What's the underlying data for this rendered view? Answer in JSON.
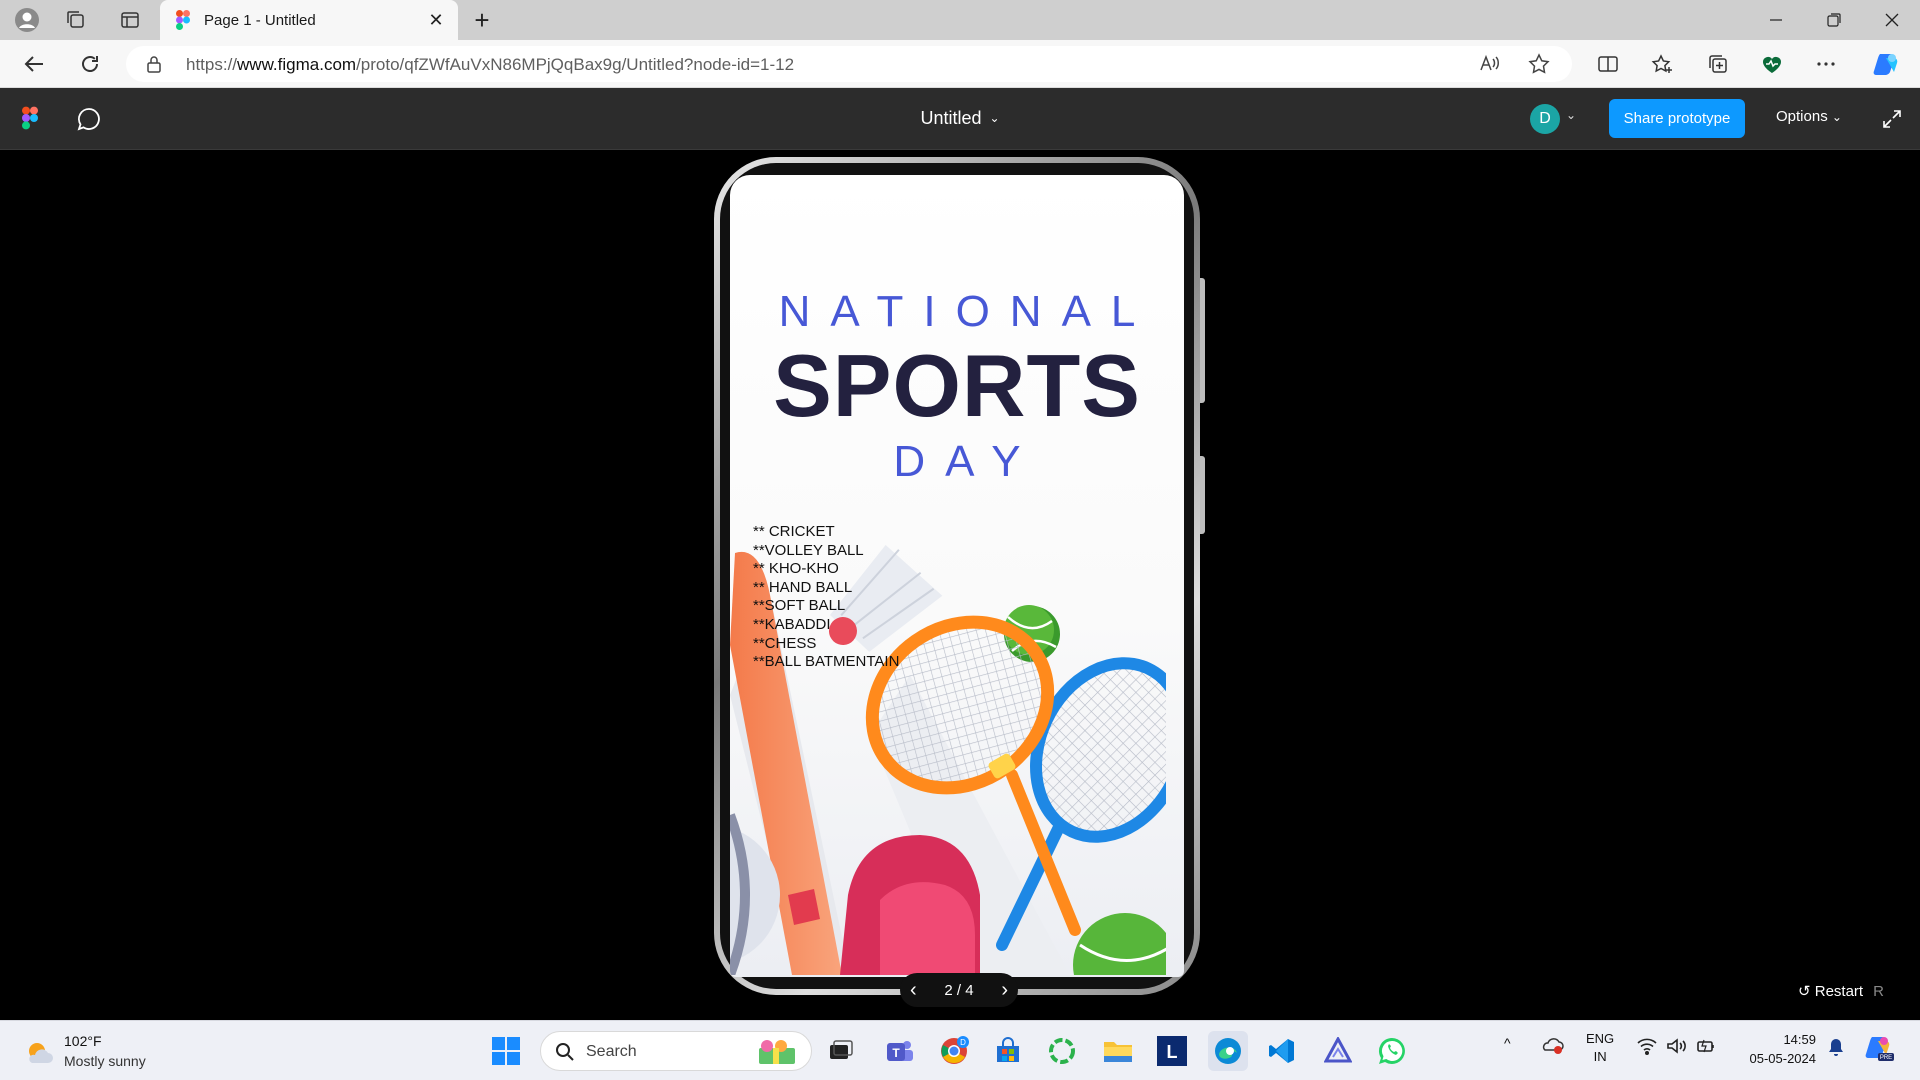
{
  "browser": {
    "tab_title": "Page 1 - Untitled",
    "url_prefix": "https://",
    "url_domain": "www.figma.com",
    "url_path": "/proto/qfZWfAuVxN86MPjQqBax9g/Untitled?node-id=1-12"
  },
  "figma": {
    "file_title": "Untitled",
    "avatar_letter": "D",
    "share_label": "Share prototype",
    "options_label": "Options",
    "pager_text": "2 / 4",
    "restart_label": "Restart",
    "restart_key": "R",
    "accent_color": "#0d99ff"
  },
  "poster": {
    "line1": "NATIONAL",
    "line2": "SPORTS",
    "line3": "DAY",
    "sports": [
      "** CRICKET",
      "**VOLLEY BALL",
      "** KHO-KHO",
      "** HAND BALL",
      "**SOFT BALL",
      "**KABADDI",
      "**CHESS",
      "**BALL BATMENTAIN"
    ],
    "title_color": "#4758d6",
    "sports_color": "#23213f"
  },
  "taskbar": {
    "temperature": "102°F",
    "weather_desc": "Mostly sunny",
    "search_placeholder": "Search",
    "lang1": "ENG",
    "lang2": "IN",
    "time": "14:59",
    "date": "05-05-2024"
  }
}
